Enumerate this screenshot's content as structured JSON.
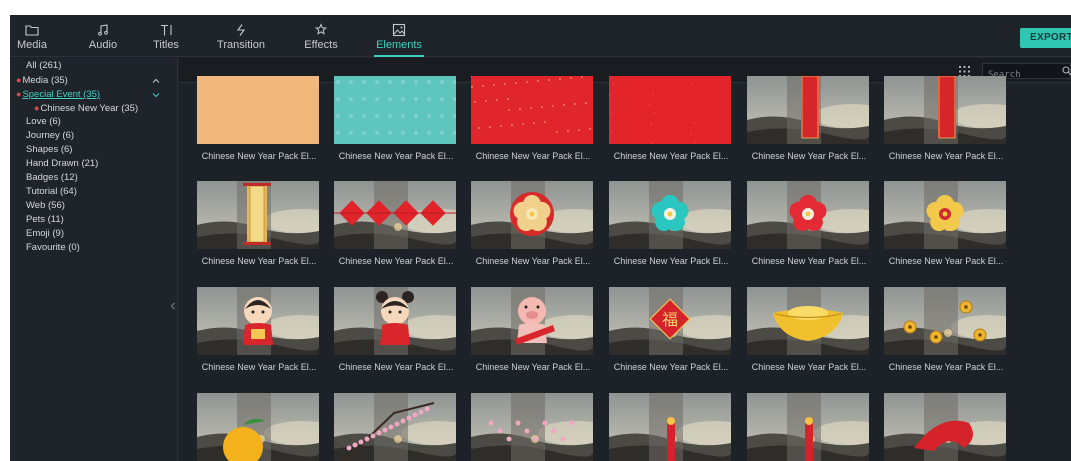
{
  "toolbar": {
    "tabs": [
      {
        "label": "Media",
        "icon": "folder-icon"
      },
      {
        "label": "Audio",
        "icon": "music-note-icon"
      },
      {
        "label": "Titles",
        "icon": "text-icon"
      },
      {
        "label": "Transition",
        "icon": "transition-icon"
      },
      {
        "label": "Effects",
        "icon": "effects-icon"
      },
      {
        "label": "Elements",
        "icon": "image-icon"
      }
    ],
    "active_tab": "Elements",
    "export_label": "EXPORT"
  },
  "sidebar": {
    "items": [
      {
        "label": "All (261)"
      },
      {
        "label": "Media (35)"
      },
      {
        "label": "Special Event (35)"
      },
      {
        "label": "Chinese New Year (35)"
      },
      {
        "label": "Love (6)"
      },
      {
        "label": "Journey (6)"
      },
      {
        "label": "Shapes (6)"
      },
      {
        "label": "Hand Drawn (21)"
      },
      {
        "label": "Badges (12)"
      },
      {
        "label": "Tutorial (64)"
      },
      {
        "label": "Web (56)"
      },
      {
        "label": "Pets (11)"
      },
      {
        "label": "Emoji (9)"
      },
      {
        "label": "Favourite (0)"
      }
    ]
  },
  "search": {
    "placeholder": "Search"
  },
  "colors": {
    "accent": "#3fd0bf",
    "export": "#2fc7b3",
    "background": "#1d2228",
    "marker": "#e2454b"
  },
  "elements": [
    {
      "caption": "Chinese New Year Pack El...",
      "kind": "orange"
    },
    {
      "caption": "Chinese New Year Pack El...",
      "kind": "teal"
    },
    {
      "caption": "Chinese New Year Pack El...",
      "kind": "red-sparkle"
    },
    {
      "caption": "Chinese New Year Pack El...",
      "kind": "red"
    },
    {
      "caption": "Chinese New Year Pack El...",
      "kind": "banner"
    },
    {
      "caption": "Chinese New Year Pack El...",
      "kind": "banner"
    },
    {
      "caption": "Chinese New Year Pack El...",
      "kind": "gold-banner"
    },
    {
      "caption": "Chinese New Year Pack El...",
      "kind": "diamonds"
    },
    {
      "caption": "Chinese New Year Pack El...",
      "kind": "flower-gold"
    },
    {
      "caption": "Chinese New Year Pack El...",
      "kind": "flower-teal"
    },
    {
      "caption": "Chinese New Year Pack El...",
      "kind": "flower-red"
    },
    {
      "caption": "Chinese New Year Pack El...",
      "kind": "flower-yellow"
    },
    {
      "caption": "Chinese New Year Pack El...",
      "kind": "boy"
    },
    {
      "caption": "Chinese New Year Pack El...",
      "kind": "girl"
    },
    {
      "caption": "Chinese New Year Pack El...",
      "kind": "pig"
    },
    {
      "caption": "Chinese New Year Pack El...",
      "kind": "fu-sign"
    },
    {
      "caption": "Chinese New Year Pack El...",
      "kind": "ingot"
    },
    {
      "caption": "Chinese New Year Pack El...",
      "kind": "coins"
    },
    {
      "caption": "",
      "kind": "tangerine"
    },
    {
      "caption": "",
      "kind": "blossom"
    },
    {
      "caption": "",
      "kind": "blossom2"
    },
    {
      "caption": "",
      "kind": "firecracker"
    },
    {
      "caption": "",
      "kind": "firecracker2"
    },
    {
      "caption": "",
      "kind": "papercut"
    }
  ]
}
